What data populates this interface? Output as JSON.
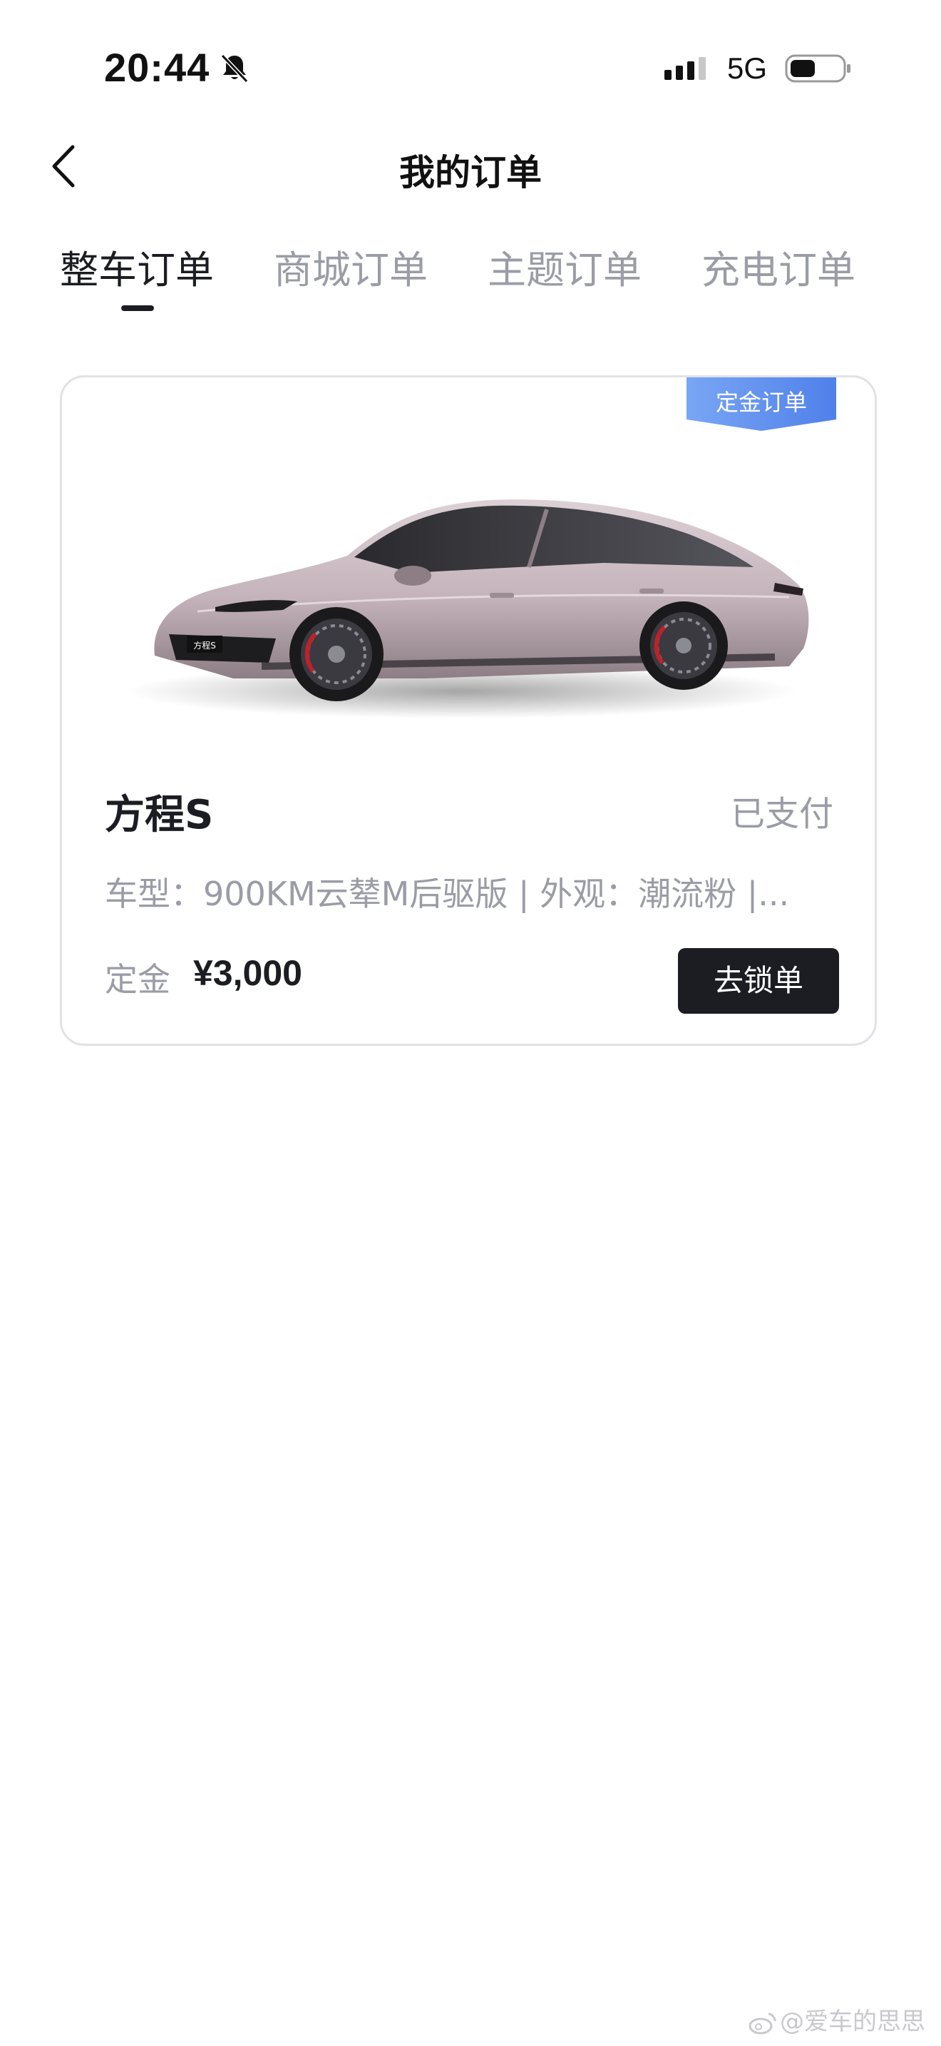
{
  "status_bar": {
    "time": "20:44",
    "network": "5G",
    "icons": [
      "bell-muted-icon",
      "signal-icon",
      "battery-icon"
    ]
  },
  "nav": {
    "title": "我的订单",
    "back_icon": "chevron-left-icon"
  },
  "tabs": [
    {
      "label": "整车订单",
      "active": true
    },
    {
      "label": "商城订单",
      "active": false
    },
    {
      "label": "主题订单",
      "active": false
    },
    {
      "label": "充电订单",
      "active": false
    }
  ],
  "order": {
    "badge": "定金订单",
    "car_name": "方程S",
    "status": "已支付",
    "spec": "车型：900KM云辇M后驱版 | 外观：潮流粉 |...",
    "deposit_label": "定金",
    "deposit_amount": "¥3,000",
    "action_label": "去锁单",
    "car_plate_text": "方程S"
  },
  "watermark": {
    "text": "@爱车的思思",
    "icon": "weibo-icon"
  },
  "colors": {
    "text_primary": "#1c1d22",
    "text_secondary": "#9a9ca6",
    "badge_blue": "#5b8def",
    "button_dark": "#1c1d22",
    "card_border": "#e1e2e6",
    "car_body": "#c9b8bf"
  }
}
